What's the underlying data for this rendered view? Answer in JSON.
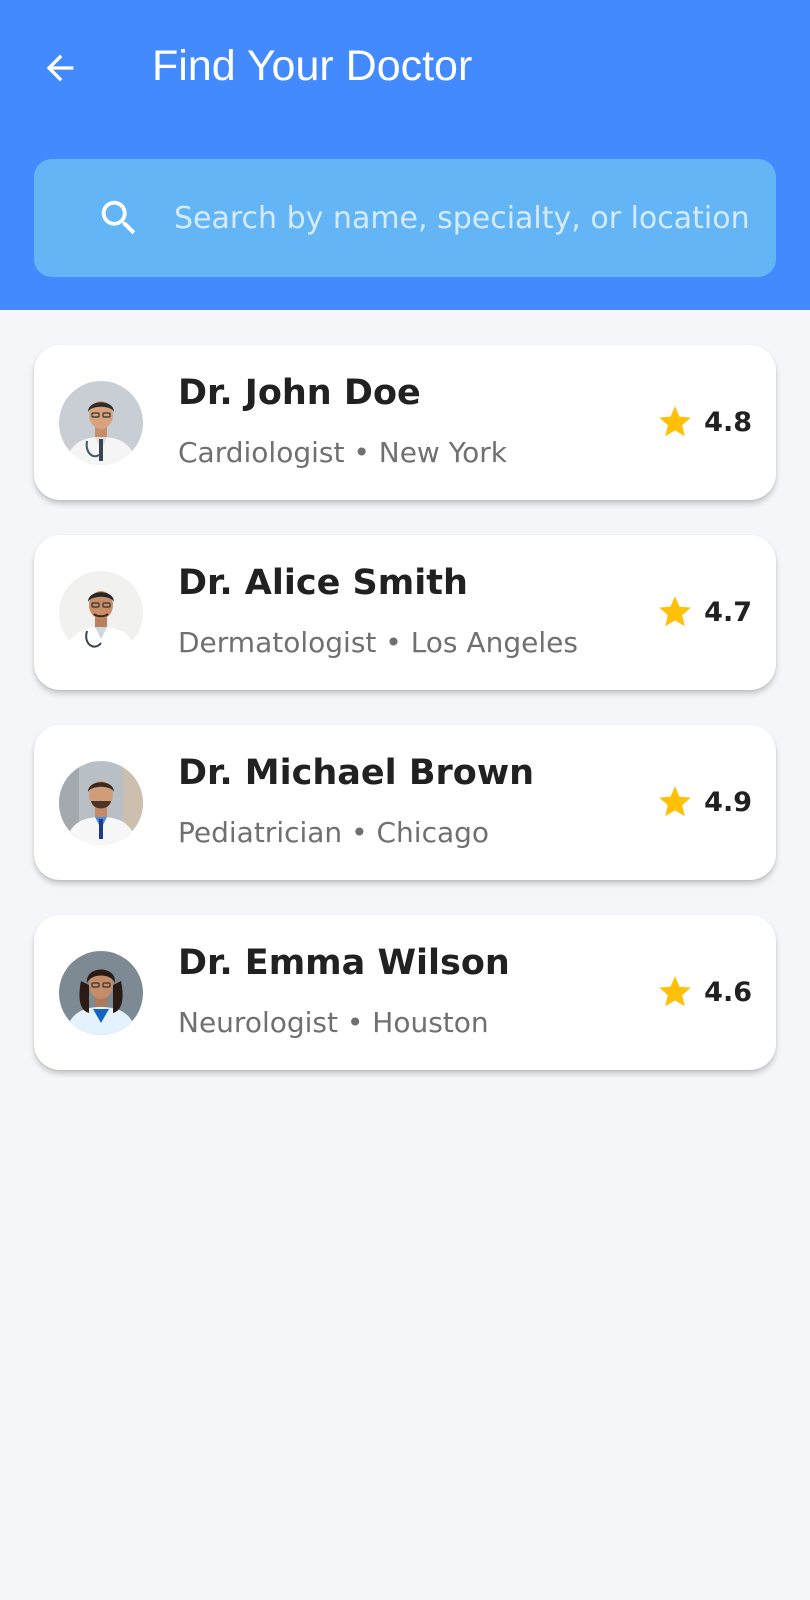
{
  "header": {
    "title": "Find Your Doctor",
    "back_icon": "arrow-left-icon",
    "background_color": "#448AFF"
  },
  "search": {
    "placeholder": "Search by name, specialty, or location",
    "value": "",
    "icon": "search-icon",
    "background_color": "#64B5F6"
  },
  "colors": {
    "star": "#FFC107",
    "name_text": "#212121",
    "sub_text": "#707070",
    "page_bg": "#F4F6FA"
  },
  "doctors": [
    {
      "name": "Dr. John Doe",
      "subtitle": "Cardiologist • New York",
      "rating": "4.8"
    },
    {
      "name": "Dr. Alice Smith",
      "subtitle": "Dermatologist • Los Angeles",
      "rating": "4.7"
    },
    {
      "name": "Dr. Michael Brown",
      "subtitle": "Pediatrician • Chicago",
      "rating": "4.9"
    },
    {
      "name": "Dr. Emma Wilson",
      "subtitle": "Neurologist • Houston",
      "rating": "4.6"
    }
  ]
}
